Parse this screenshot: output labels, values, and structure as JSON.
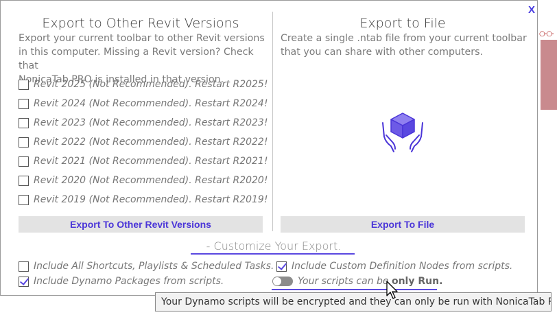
{
  "dialog": {
    "close_label": "X"
  },
  "left": {
    "title": "Export to Other Revit Versions",
    "description_lines": [
      "Export your current toolbar to other Revit versions",
      "in this computer. Missing a Revit version? Check that",
      "NonicaTab PRO is installed in that version."
    ],
    "versions": [
      {
        "label": "Revit 2025 (Not Recommended). Restart R2025!",
        "checked": false
      },
      {
        "label": "Revit 2024 (Not Recommended). Restart R2024!",
        "checked": false
      },
      {
        "label": "Revit 2023 (Not Recommended). Restart R2023!",
        "checked": false
      },
      {
        "label": "Revit 2022 (Not Recommended). Restart R2022!",
        "checked": false
      },
      {
        "label": "Revit 2021 (Not Recommended). Restart R2021!",
        "checked": false
      },
      {
        "label": "Revit 2020 (Not Recommended). Restart R2020!",
        "checked": false
      },
      {
        "label": "Revit 2019 (Not Recommended). Restart R2019!",
        "checked": false
      }
    ],
    "button_label": "Export To Other Revit Versions"
  },
  "right": {
    "title": "Export to File",
    "description_lines": [
      "Create a single .ntab file from your current toolbar",
      "that you can share with other computers."
    ],
    "icon": "hands-holding-box-icon",
    "button_label": "Export To File"
  },
  "customize": {
    "heading": "- Customize Your Export.",
    "options": {
      "include_shortcuts": {
        "label": "Include All Shortcuts, Playlists & Scheduled Tasks.",
        "checked": false
      },
      "include_custom_nodes": {
        "label": "Include Custom Definition Nodes from scripts.",
        "checked": true
      },
      "include_dynamo_packages": {
        "label": "Include Dynamo Packages from scripts.",
        "checked": true
      }
    },
    "toggle": {
      "text_prefix": "Your scripts can be ",
      "text_strong": "only Run.",
      "on": false
    }
  },
  "tooltip": {
    "text": "Your Dynamo scripts will be encrypted and they can only be run with NonicaTab PRO."
  },
  "colors": {
    "accent": "#5a48e0",
    "button_text": "#4a35d8",
    "button_bg": "#e3e3e3"
  }
}
